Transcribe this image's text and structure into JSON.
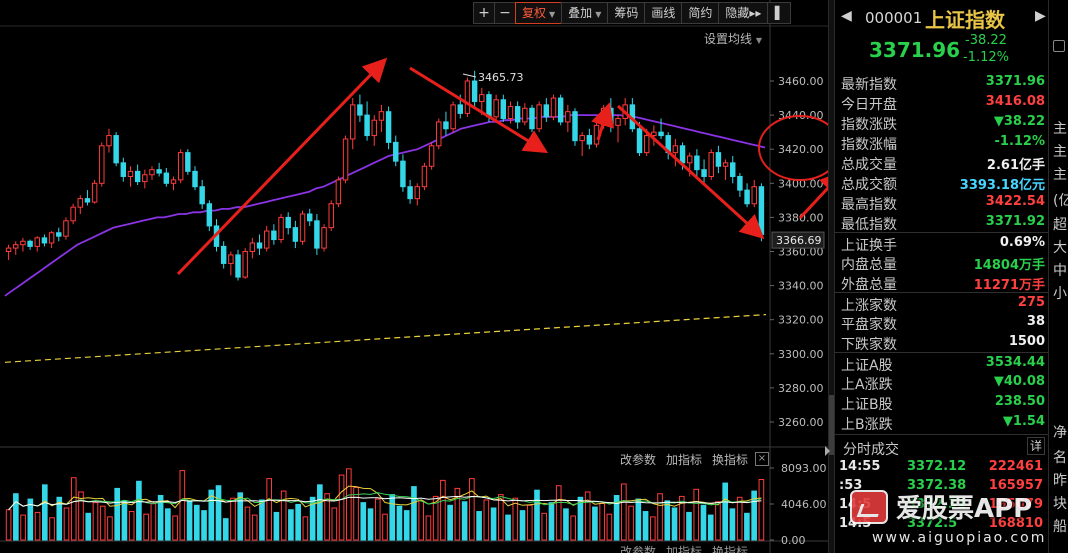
{
  "toolbar": {
    "zoom_in": "+",
    "zoom_out": "−",
    "adjust": "复权",
    "overlay": "叠加",
    "chips": "筹码",
    "drawline": "画线",
    "simple": "简约",
    "hide": "隐藏",
    "next": "▸▸"
  },
  "setting_ma": "设置均线",
  "vol_panel": {
    "params": "改参数",
    "add_indicator": "加指标",
    "switch_indicator": "换指标",
    "close": "×",
    "params_2": "改参数",
    "add_indicator_2": "加指标",
    "switch_indicator_2": "换指标"
  },
  "price_axis": {
    "labels": [
      "3460.00",
      "3440.00",
      "3420.00",
      "3400.00",
      "3380.00",
      "3360.00",
      "3340.00",
      "3320.00",
      "3300.00",
      "3280.00",
      "3260.00"
    ],
    "last_price_tag": "3366.69",
    "high_label": "3465.73"
  },
  "volume_axis": {
    "labels": [
      "8093.00",
      "4046.00",
      "0.00"
    ]
  },
  "header": {
    "prev": "◀",
    "next": "▶",
    "code": "000001",
    "name": "上证指数",
    "price": "3371.96",
    "change": "-38.22",
    "change_pct": "-1.12%"
  },
  "quote_rows": [
    {
      "label": "最新指数",
      "value": "3371.96",
      "color": "green"
    },
    {
      "label": "今日开盘",
      "value": "3416.08",
      "color": "red"
    },
    {
      "label": "指数涨跌",
      "value": "▼38.22",
      "color": "green"
    },
    {
      "label": "指数涨幅",
      "value": "-1.12%",
      "color": "green"
    },
    {
      "label": "总成交量",
      "value": "2.61亿手",
      "color": "white"
    },
    {
      "label": "总成交额",
      "value": "3393.18亿元",
      "color": "cyan"
    },
    {
      "label": "最高指数",
      "value": "3422.54",
      "color": "red"
    },
    {
      "label": "最低指数",
      "value": "3371.92",
      "color": "green"
    },
    {
      "label": "上证换手",
      "value": "0.69%",
      "color": "white",
      "sep": true
    },
    {
      "label": "内盘总量",
      "value": "14804万手",
      "color": "green"
    },
    {
      "label": "外盘总量",
      "value": "11271万手",
      "color": "red"
    },
    {
      "label": "上涨家数",
      "value": "275",
      "color": "red",
      "sep": true
    },
    {
      "label": "平盘家数",
      "value": "38",
      "color": "white"
    },
    {
      "label": "下跌家数",
      "value": "1500",
      "color": "white"
    },
    {
      "label": "上证A股",
      "value": "3534.44",
      "color": "green",
      "sep": true
    },
    {
      "label": "上A涨跌",
      "value": "▼40.08",
      "color": "green"
    },
    {
      "label": "上证B股",
      "value": "238.50",
      "color": "green"
    },
    {
      "label": "上B涨跌",
      "value": "▼1.54",
      "color": "green"
    }
  ],
  "ticks": {
    "title": "分时成交",
    "detail": "详",
    "rows": [
      {
        "time": "14:55",
        "price": "3372.12",
        "vol": "222461"
      },
      {
        "time": ":53",
        "price": "3372.38",
        "vol": "165957"
      },
      {
        "time": "14:5",
        "price": "3372.31",
        "vol": "195079"
      },
      {
        "time": "14:5",
        "price": "3372.5",
        "vol": "168810"
      }
    ]
  },
  "strip": {
    "chars": [
      "主",
      "主",
      "主",
      "(亿",
      "超",
      "大",
      "中",
      "小",
      "净",
      "名",
      "昨",
      "块",
      "船"
    ]
  },
  "watermark": {
    "text": "爱股票APP",
    "url": "www.aiguopiao.com"
  },
  "chart_data": {
    "type": "candlestick",
    "symbol": "上证指数",
    "ylim": [
      3250,
      3470
    ],
    "ohlc": [
      [
        3360,
        3364,
        3355,
        3362
      ],
      [
        3362,
        3366,
        3358,
        3364
      ],
      [
        3364,
        3368,
        3360,
        3366
      ],
      [
        3366,
        3367,
        3361,
        3363
      ],
      [
        3363,
        3369,
        3360,
        3368
      ],
      [
        3368,
        3370,
        3363,
        3365
      ],
      [
        3365,
        3372,
        3362,
        3371
      ],
      [
        3371,
        3374,
        3366,
        3369
      ],
      [
        3369,
        3380,
        3367,
        3378
      ],
      [
        3378,
        3388,
        3376,
        3386
      ],
      [
        3386,
        3393,
        3382,
        3391
      ],
      [
        3391,
        3396,
        3387,
        3389
      ],
      [
        3389,
        3402,
        3388,
        3400
      ],
      [
        3400,
        3424,
        3398,
        3422
      ],
      [
        3422,
        3432,
        3418,
        3428
      ],
      [
        3428,
        3430,
        3410,
        3412
      ],
      [
        3412,
        3415,
        3401,
        3404
      ],
      [
        3404,
        3410,
        3398,
        3407
      ],
      [
        3407,
        3411,
        3399,
        3401
      ],
      [
        3401,
        3408,
        3397,
        3405
      ],
      [
        3405,
        3410,
        3402,
        3408
      ],
      [
        3408,
        3412,
        3404,
        3406
      ],
      [
        3406,
        3409,
        3398,
        3400
      ],
      [
        3400,
        3404,
        3396,
        3402
      ],
      [
        3402,
        3420,
        3400,
        3418
      ],
      [
        3418,
        3420,
        3405,
        3407
      ],
      [
        3407,
        3410,
        3396,
        3398
      ],
      [
        3398,
        3402,
        3385,
        3388
      ],
      [
        3388,
        3390,
        3372,
        3375
      ],
      [
        3375,
        3379,
        3360,
        3363
      ],
      [
        3363,
        3366,
        3350,
        3353
      ],
      [
        3353,
        3360,
        3346,
        3358
      ],
      [
        3358,
        3361,
        3343,
        3345
      ],
      [
        3345,
        3362,
        3344,
        3360
      ],
      [
        3360,
        3368,
        3356,
        3365
      ],
      [
        3365,
        3370,
        3358,
        3362
      ],
      [
        3362,
        3375,
        3360,
        3372
      ],
      [
        3372,
        3376,
        3364,
        3367
      ],
      [
        3367,
        3382,
        3365,
        3380
      ],
      [
        3380,
        3383,
        3370,
        3374
      ],
      [
        3374,
        3378,
        3362,
        3366
      ],
      [
        3366,
        3384,
        3364,
        3382
      ],
      [
        3382,
        3385,
        3375,
        3378
      ],
      [
        3378,
        3382,
        3358,
        3362
      ],
      [
        3362,
        3376,
        3360,
        3374
      ],
      [
        3374,
        3390,
        3372,
        3388
      ],
      [
        3388,
        3404,
        3386,
        3402
      ],
      [
        3402,
        3428,
        3400,
        3426
      ],
      [
        3426,
        3450,
        3420,
        3446
      ],
      [
        3446,
        3452,
        3436,
        3440
      ],
      [
        3440,
        3448,
        3425,
        3428
      ],
      [
        3428,
        3440,
        3422,
        3437
      ],
      [
        3437,
        3446,
        3430,
        3442
      ],
      [
        3442,
        3445,
        3420,
        3424
      ],
      [
        3424,
        3428,
        3410,
        3413
      ],
      [
        3413,
        3417,
        3395,
        3398
      ],
      [
        3398,
        3402,
        3388,
        3391
      ],
      [
        3391,
        3400,
        3387,
        3398
      ],
      [
        3398,
        3412,
        3396,
        3410
      ],
      [
        3410,
        3424,
        3408,
        3422
      ],
      [
        3422,
        3438,
        3420,
        3436
      ],
      [
        3436,
        3442,
        3428,
        3432
      ],
      [
        3432,
        3448,
        3430,
        3446
      ],
      [
        3446,
        3452,
        3438,
        3441
      ],
      [
        3441,
        3462,
        3439,
        3460
      ],
      [
        3460,
        3466,
        3444,
        3448
      ],
      [
        3448,
        3456,
        3440,
        3452
      ],
      [
        3452,
        3454,
        3436,
        3439
      ],
      [
        3439,
        3452,
        3436,
        3449
      ],
      [
        3449,
        3452,
        3436,
        3438
      ],
      [
        3438,
        3448,
        3435,
        3445
      ],
      [
        3445,
        3448,
        3432,
        3436
      ],
      [
        3436,
        3447,
        3434,
        3444
      ],
      [
        3444,
        3446,
        3430,
        3432
      ],
      [
        3432,
        3448,
        3430,
        3446
      ],
      [
        3446,
        3450,
        3436,
        3439
      ],
      [
        3439,
        3452,
        3437,
        3450
      ],
      [
        3450,
        3452,
        3434,
        3436
      ],
      [
        3436,
        3446,
        3430,
        3442
      ],
      [
        3442,
        3444,
        3422,
        3425
      ],
      [
        3425,
        3430,
        3416,
        3428
      ],
      [
        3428,
        3432,
        3420,
        3423
      ],
      [
        3423,
        3437,
        3421,
        3434
      ],
      [
        3434,
        3446,
        3432,
        3444
      ],
      [
        3444,
        3450,
        3430,
        3434
      ],
      [
        3434,
        3440,
        3424,
        3438
      ],
      [
        3438,
        3450,
        3434,
        3446
      ],
      [
        3446,
        3450,
        3430,
        3432
      ],
      [
        3432,
        3436,
        3416,
        3418
      ],
      [
        3418,
        3432,
        3416,
        3428
      ],
      [
        3428,
        3434,
        3422,
        3430
      ],
      [
        3430,
        3438,
        3426,
        3428
      ],
      [
        3428,
        3430,
        3414,
        3418
      ],
      [
        3418,
        3426,
        3410,
        3422
      ],
      [
        3422,
        3424,
        3408,
        3412
      ],
      [
        3412,
        3418,
        3404,
        3416
      ],
      [
        3416,
        3420,
        3404,
        3408
      ],
      [
        3408,
        3414,
        3400,
        3404
      ],
      [
        3404,
        3420,
        3402,
        3418
      ],
      [
        3418,
        3422,
        3406,
        3410
      ],
      [
        3410,
        3414,
        3402,
        3412
      ],
      [
        3412,
        3416,
        3400,
        3404
      ],
      [
        3404,
        3406,
        3392,
        3396
      ],
      [
        3396,
        3400,
        3386,
        3388
      ],
      [
        3388,
        3402,
        3386,
        3398
      ],
      [
        3398,
        3400,
        3366,
        3370
      ]
    ],
    "ma_long": [
      3334,
      3337,
      3340,
      3343,
      3346,
      3349,
      3352,
      3355,
      3358,
      3361,
      3364,
      3366,
      3368,
      3370,
      3372,
      3374,
      3375,
      3376,
      3377,
      3378,
      3379,
      3380,
      3380,
      3381,
      3382,
      3382,
      3383,
      3383,
      3384,
      3384,
      3385,
      3385,
      3386,
      3386,
      3387,
      3388,
      3389,
      3390,
      3391,
      3392,
      3393,
      3394,
      3395,
      3397,
      3398,
      3400,
      3402,
      3404,
      3406,
      3408,
      3410,
      3412,
      3414,
      3416,
      3417,
      3418,
      3419,
      3420,
      3422,
      3424,
      3426,
      3428,
      3430,
      3432,
      3433,
      3434,
      3435,
      3436,
      3436,
      3437,
      3437,
      3438,
      3438,
      3438,
      3439,
      3439,
      3439,
      3439,
      3440,
      3440,
      3440,
      3440,
      3440,
      3440,
      3440,
      3440,
      3439,
      3439,
      3438,
      3437,
      3436,
      3435,
      3434,
      3433,
      3432,
      3431,
      3430,
      3429,
      3428,
      3427,
      3426,
      3425,
      3424,
      3423,
      3422,
      3421
    ],
    "ma_very_long": [
      3295,
      3323
    ],
    "volume": {
      "ylim": [
        0,
        8093
      ],
      "values": [
        3400,
        5200,
        2800,
        4600,
        3100,
        6200,
        2500,
        4800,
        3600,
        7000,
        5400,
        3000,
        4200,
        3800,
        2600,
        5800,
        4400,
        3200,
        6600,
        2900,
        4100,
        5000,
        3500,
        2700,
        7800,
        4300,
        3900,
        3300,
        5600,
        6100,
        2400,
        4700,
        5300,
        3700,
        2800,
        4500,
        6900,
        3100,
        5500,
        3400,
        4000,
        2600,
        4800,
        6200,
        5200,
        3600,
        7300,
        8000,
        5900,
        4200,
        3500,
        4600,
        2900,
        5100,
        3800,
        3300,
        6000,
        4400,
        2700,
        4900,
        6700,
        3900,
        5800,
        4300,
        6900,
        3200,
        4500,
        3600,
        5100,
        2800,
        4700,
        3300,
        3900,
        5600,
        3000,
        4200,
        6100,
        3500,
        2700,
        4800,
        5400,
        3700,
        4100,
        2900,
        5000,
        6300,
        3800,
        4600,
        3200,
        2600,
        5200,
        4400,
        3600,
        4900,
        3100,
        5700,
        3900,
        2800,
        4300,
        6400,
        3500,
        4800,
        3000,
        5500,
        6800
      ],
      "up": [
        1,
        0,
        1,
        0,
        1,
        0,
        1,
        0,
        1,
        1,
        1,
        0,
        1,
        1,
        1,
        0,
        0,
        1,
        0,
        1,
        1,
        0,
        0,
        1,
        1,
        0,
        0,
        0,
        0,
        0,
        0,
        1,
        0,
        1,
        1,
        0,
        1,
        0,
        1,
        0,
        0,
        1,
        0,
        0,
        1,
        1,
        1,
        1,
        1,
        0,
        0,
        1,
        1,
        0,
        0,
        0,
        0,
        1,
        1,
        1,
        1,
        0,
        1,
        0,
        1,
        0,
        1,
        0,
        1,
        0,
        1,
        0,
        1,
        0,
        1,
        0,
        1,
        0,
        1,
        0,
        1,
        0,
        1,
        1,
        0,
        1,
        1,
        0,
        0,
        1,
        1,
        0,
        0,
        1,
        0,
        1,
        0,
        0,
        1,
        0,
        0,
        1,
        0,
        0,
        1,
        0
      ]
    }
  }
}
